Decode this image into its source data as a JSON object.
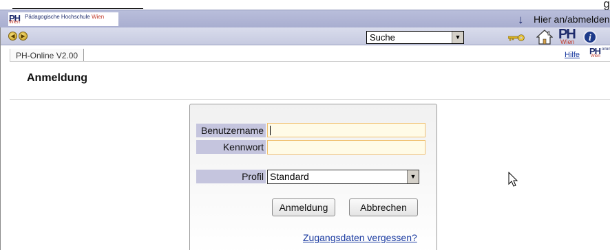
{
  "top_strip": {
    "right_text": "g"
  },
  "header": {
    "logo": {
      "mark": "PH",
      "mark_sub": "Wien",
      "name_prefix": "Pädagogische Hochschule ",
      "name_suffix": "Wien"
    },
    "login_link": "Hier an/abmelden"
  },
  "toolbar": {
    "search_select": {
      "selected": "Suche"
    },
    "icons": [
      "back-icon",
      "forward-icon",
      "key-icon",
      "home-icon",
      "ph-wien-logo-icon",
      "info-icon"
    ],
    "ph_logo": {
      "mark": "PH",
      "sub": "Wien"
    },
    "info_glyph": "i"
  },
  "tabrow": {
    "tab_label": "PH-Online V2.00",
    "help_link": "Hilfe",
    "ph_online_logo": {
      "mark": "PH",
      "sub": "online",
      "city": "Wien"
    }
  },
  "page": {
    "title": "Anmeldung"
  },
  "login_form": {
    "username_label": "Benutzername",
    "username_value": "",
    "password_label": "Kennwort",
    "password_value": "",
    "profile_label": "Profil",
    "profile_selected": "Standard",
    "submit_label": "Anmeldung",
    "cancel_label": "Abbrechen",
    "forgot_link": "Zugangsdaten vergessen?"
  },
  "colors": {
    "header_band": "#b9bedb",
    "label_bg": "#c5c5de",
    "input_bg": "#fffbe7",
    "input_border": "#f0c070",
    "link": "#1a3aa0",
    "brand_dark": "#1d2a6b",
    "brand_red": "#c0392b"
  }
}
